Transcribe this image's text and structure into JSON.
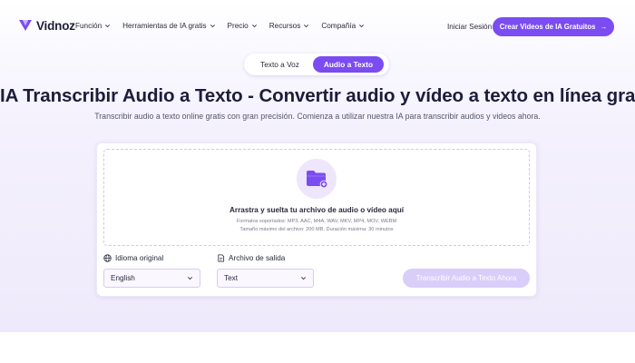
{
  "nav": {
    "logo_text": "Vidnoz",
    "menu": [
      {
        "label": "Función"
      },
      {
        "label": "Herramientas de IA gratis"
      },
      {
        "label": "Precio"
      },
      {
        "label": "Recursos"
      },
      {
        "label": "Compañía"
      }
    ],
    "login_label": "Iniciar Sesión",
    "cta_label": "Crear Videos de IA Gratuitos",
    "cta_arrow": "→"
  },
  "tabs": [
    {
      "label": "Texto a Voz",
      "active": false
    },
    {
      "label": "Audio a Texto",
      "active": true
    }
  ],
  "hero": {
    "title": "IA Transcribir Audio a Texto - Convertir audio y vídeo a texto en línea gratis",
    "subtitle": "Transcribir audio a texto online gratis con gran precisión. Comienza a utilizar nuestra IA para transcribir audios y videos ahora."
  },
  "upload": {
    "main_text": "Arrastra y suelta tu archivo de audio o vídeo aquí",
    "formats_text": "Formatos soportados: MP3, AAC, M4A, WAV, MKV, MP4, MOV, WEBM",
    "limits_text": "Tamaño máximo del archivo: 200 MB. Duración máxima: 30 minutos",
    "icon": "folder-plus-icon"
  },
  "options": {
    "language_label": "Idioma original",
    "language_value": "English",
    "output_label": "Archivo de salida",
    "output_value": "Text"
  },
  "transcribe_label": "Transcribir Audio a Texto Ahora",
  "colors": {
    "accent": "#7b4cf1",
    "accent_disabled": "#d9cdfa",
    "text_dark": "#1d1d3a"
  }
}
